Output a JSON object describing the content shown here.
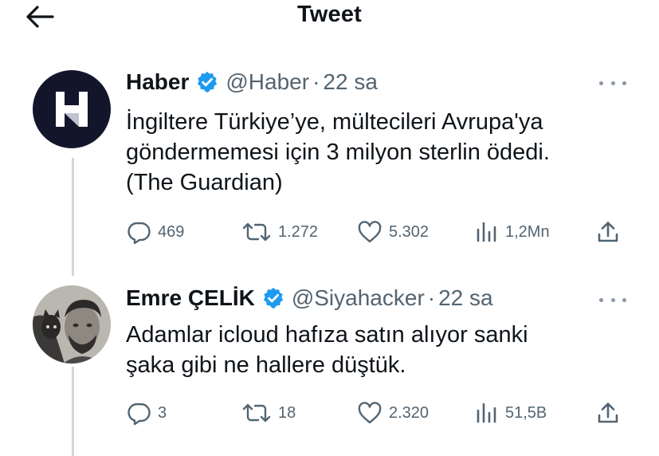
{
  "header": {
    "title": "Tweet"
  },
  "tweets": [
    {
      "name": "Haber",
      "handle": "@Haber",
      "separator": "·",
      "time": "22 sa",
      "avatar_letter": "H",
      "text_lines": [
        "İngiltere Türkiye’ye, mültecileri Avrupa'ya",
        "göndermemesi için 3 milyon sterlin ödedi.",
        "(The Guardian)"
      ],
      "replies": "469",
      "retweets": "1.272",
      "likes": "5.302",
      "views": "1,2Mn"
    },
    {
      "name": "Emre ÇELİK",
      "handle": "@Siyahacker",
      "separator": "·",
      "time": "22 sa",
      "text_lines": [
        "Adamlar icloud hafıza satın alıyor sanki",
        "şaka gibi ne hallere düştük."
      ],
      "replies": "3",
      "retweets": "18",
      "likes": "2.320",
      "views": "51,5B"
    }
  ],
  "icons": {
    "back": "arrow-left-icon",
    "verified": "verified-badge-icon",
    "more": "more-horizontal-icon",
    "reply": "reply-icon",
    "retweet": "retweet-icon",
    "like": "heart-icon",
    "views": "views-icon",
    "share": "share-icon"
  },
  "colors": {
    "text": "#0f1419",
    "secondary": "#536471",
    "verified": "#1d9bf0",
    "haber_avatar_bg": "#13162b"
  }
}
